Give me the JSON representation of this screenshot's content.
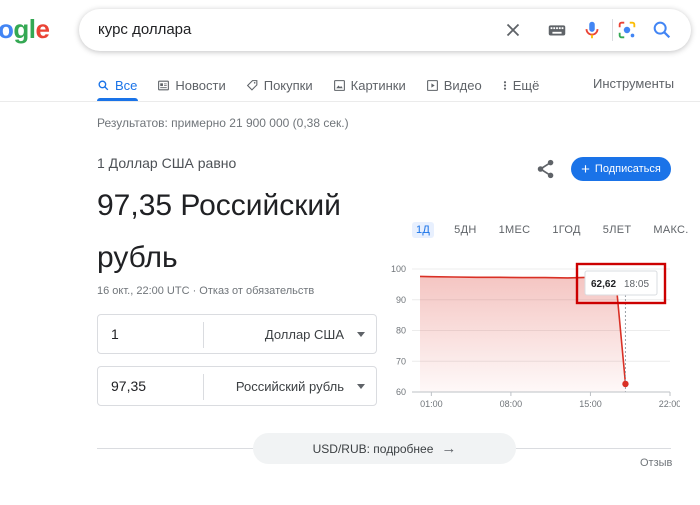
{
  "logo": {
    "text_part1": "o",
    "text_part2": "g",
    "text_part3": "l",
    "text_part4": "e"
  },
  "search": {
    "query": "курс доллара"
  },
  "tabs": [
    {
      "label": "Все",
      "icon": "search-icon",
      "active": true
    },
    {
      "label": "Новости",
      "icon": "news-icon"
    },
    {
      "label": "Покупки",
      "icon": "tag-icon"
    },
    {
      "label": "Картинки",
      "icon": "image-icon"
    },
    {
      "label": "Видео",
      "icon": "video-icon"
    },
    {
      "label": "Ещё",
      "icon": "more-vert-icon"
    }
  ],
  "tools_label": "Инструменты",
  "result_stats": "Результатов: примерно 21 900 000 (0,38 сек.)",
  "converter": {
    "equals_label": "1 Доллар США равно",
    "result_value": "97,35 Российский рубль",
    "timestamp": "16 окт., 22:00 UTC · Отказ от обязательств",
    "from_amount": "1",
    "from_currency": "Доллар США",
    "to_amount": "97,35",
    "to_currency": "Российский рубль"
  },
  "subscribe_label": "Подписаться",
  "ranges": [
    "1Д",
    "5ДН",
    "1МЕС",
    "1ГОД",
    "5ЛЕТ",
    "МАКС."
  ],
  "active_range": "1Д",
  "tooltip": {
    "value": "62,62",
    "time": "18:05"
  },
  "more_button_label": "USD/RUB: подробнее",
  "feedback_label": "Отзыв",
  "colors": {
    "accent": "#1a73e8",
    "line": "#d93025",
    "highlight_box": "#cc0000"
  },
  "chart_data": {
    "type": "area",
    "x_ticks": [
      "01:00",
      "08:00",
      "15:00",
      "22:00"
    ],
    "y_ticks": [
      60,
      70,
      80,
      90,
      100
    ],
    "ylim": [
      60,
      100
    ],
    "x_hours": [
      0,
      1,
      3,
      5,
      7,
      9,
      11,
      13,
      15,
      16.5,
      17.2,
      18.08
    ],
    "values": [
      97.6,
      97.5,
      97.4,
      97.3,
      97.3,
      97.2,
      97.2,
      97.1,
      97.3,
      97.4,
      97.5,
      62.62
    ],
    "x_domain_hours": [
      0,
      22
    ]
  }
}
